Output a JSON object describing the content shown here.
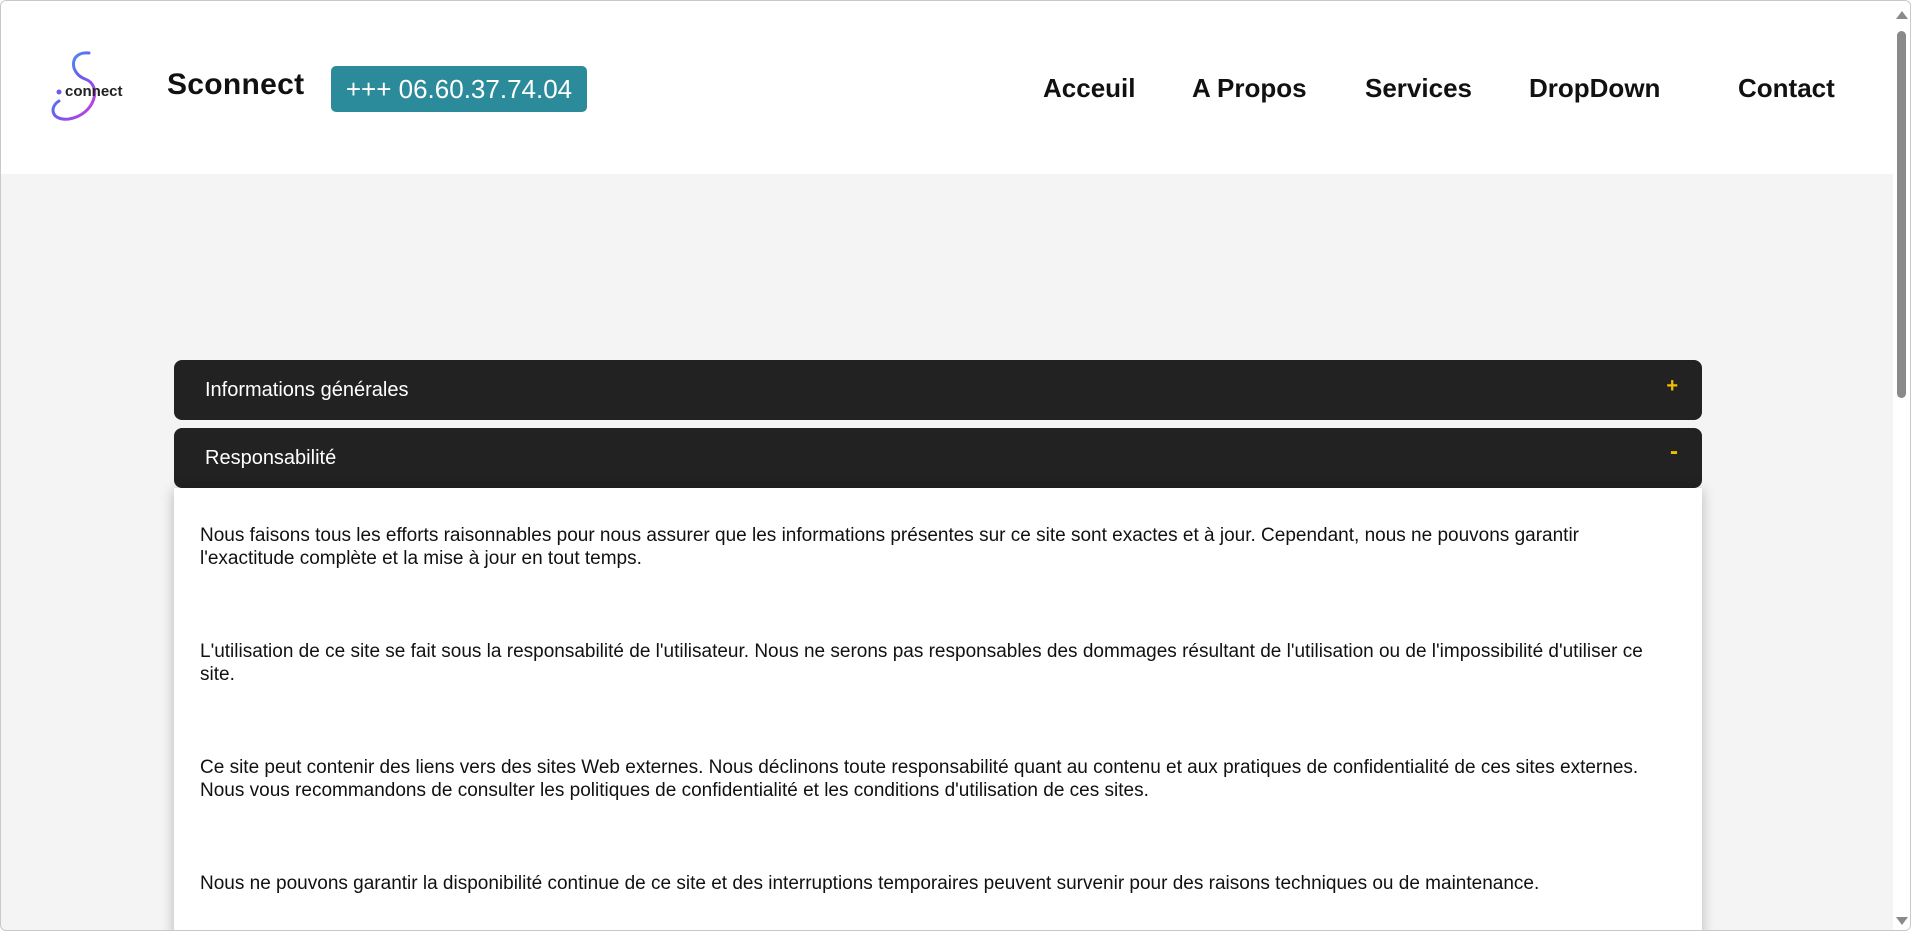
{
  "header": {
    "brand": "Sconnect",
    "logo_text": "connect",
    "phone": "+++ 06.60.37.74.04",
    "nav": [
      "Acceuil",
      "A Propos",
      "Services",
      "DropDown",
      "Contact"
    ]
  },
  "accordion": [
    {
      "title": "Informations générales",
      "sign": "+",
      "expanded": false
    },
    {
      "title": "Responsabilité",
      "sign": "-",
      "expanded": true
    }
  ],
  "content": {
    "paragraphs": [
      "Nous faisons tous les efforts raisonnables pour nous assurer que les informations présentes sur ce site sont exactes et à jour. Cependant, nous ne pouvons garantir l'exactitude complète et la mise à jour en tout temps.",
      "L'utilisation de ce site se fait sous la responsabilité de l'utilisateur. Nous ne serons pas responsables des dommages résultant de l'utilisation ou de l'impossibilité d'utiliser ce site.",
      "Ce site peut contenir des liens vers des sites Web externes. Nous déclinons toute responsabilité quant au contenu et aux pratiques de confidentialité de ces sites externes. Nous vous recommandons de consulter les politiques de confidentialité et les conditions d'utilisation de ces sites.",
      "Nous ne pouvons garantir la disponibilité continue de ce site et des interruptions temporaires peuvent survenir pour des raisons techniques ou de maintenance."
    ]
  },
  "colors": {
    "accent": "#2b8b9a",
    "accordion_bg": "#222222",
    "accordion_sign": "#f0c000",
    "page_bg": "#f4f4f4"
  },
  "icons": {
    "logo": "sconnect-logo-icon",
    "scroll_up": "scroll-up-arrow-icon",
    "scroll_down": "scroll-down-arrow-icon"
  }
}
